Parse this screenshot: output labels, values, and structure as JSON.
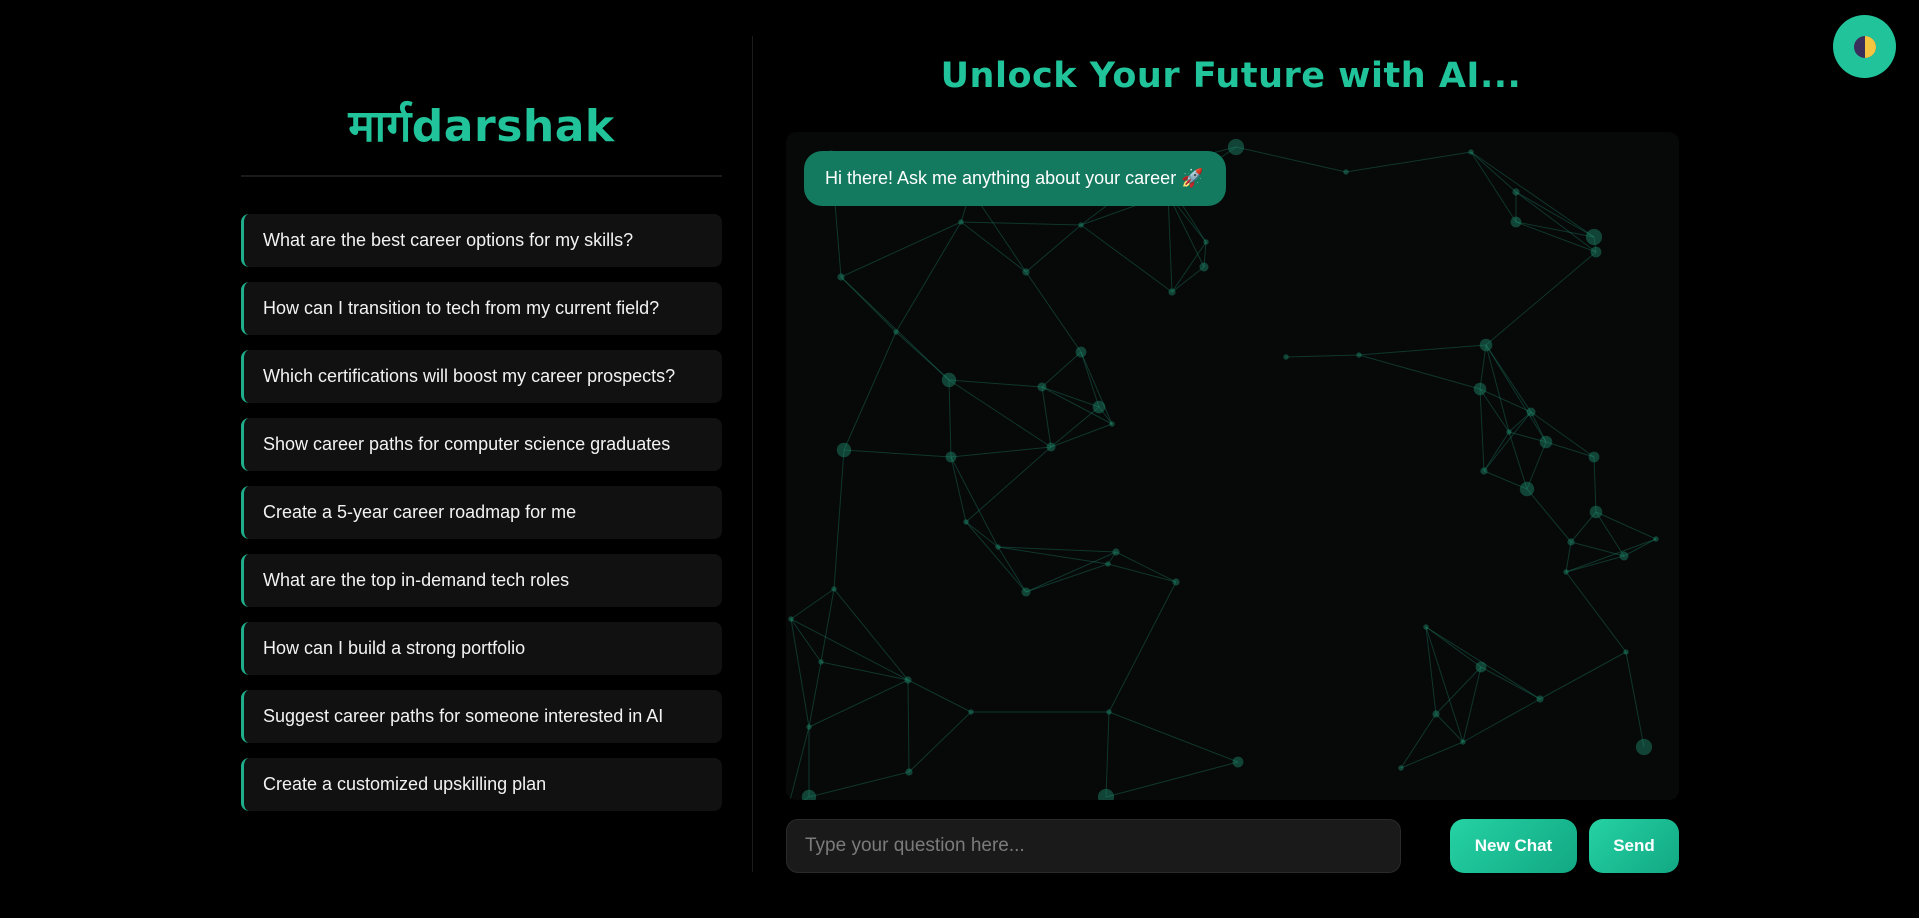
{
  "sidebar": {
    "logo": "मार्गdarshak",
    "prompts": [
      "What are the best career options for my skills?",
      "How can I transition to tech from my current field?",
      "Which certifications will boost my career prospects?",
      "Show career paths for computer science graduates",
      "Create a 5-year career roadmap for me",
      "What are the top in-demand tech roles",
      "How can I build a strong portfolio",
      "Suggest career paths for someone interested in AI",
      "Create a customized upskilling plan"
    ]
  },
  "main": {
    "title": "Unlock Your Future with AI...",
    "greeting": "Hi there! Ask me anything about your career 🚀",
    "input_placeholder": "Type your question here...",
    "input_value": "",
    "new_chat_label": "New Chat",
    "send_label": "Send"
  },
  "theme_toggle": {
    "icon": "contrast-icon"
  },
  "colors": {
    "accent": "#21c49a",
    "bubble": "#137a5f",
    "background": "#000000",
    "network": "#1f8f6f"
  }
}
